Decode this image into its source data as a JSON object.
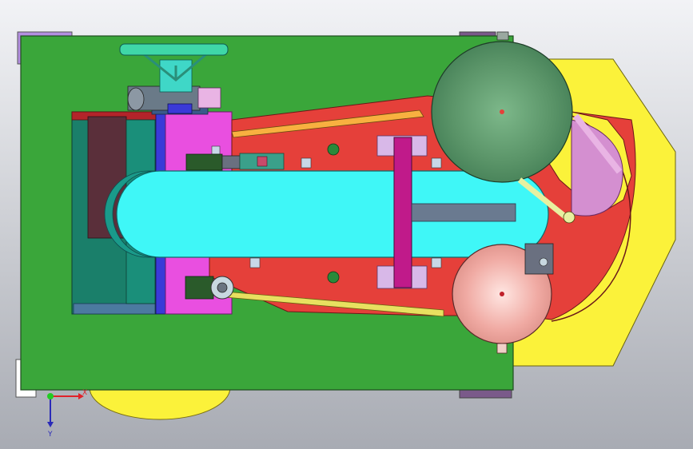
{
  "viewport": {
    "background_top": "#f2f3f6",
    "background_bottom": "#a8abb3"
  },
  "colors": {
    "base_plate": "#3aa63a",
    "yellow_guard": "#fbf23a",
    "red_frame": "#e5403a",
    "cyan_belt": "#3ff7f7",
    "magenta_block": "#e94fe0",
    "teal_motor": "#1a7f6a",
    "maroon_panel": "#5a2f3a",
    "blue_strip": "#3a3ad8",
    "green_pulley": "#5d9a6c",
    "pink_pulley": "#f4b4b0",
    "violet_plate": "#d48fd0",
    "purple_trim": "#b38fe0"
  },
  "triad": {
    "x_label": "X",
    "y_label": "Y",
    "x_color": "#e0222a",
    "y_color": "#2a2ab8",
    "origin_color": "#22cc22"
  }
}
